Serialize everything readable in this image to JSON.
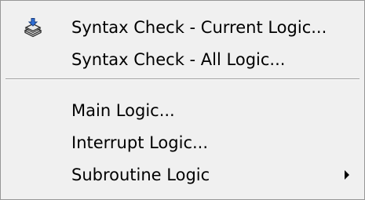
{
  "menu": {
    "items": [
      {
        "label": "Syntax Check - Current Logic...",
        "icon": "syntax-check-icon"
      },
      {
        "label": "Syntax Check - All Logic..."
      },
      {
        "label": "Main Logic..."
      },
      {
        "label": "Interrupt Logic..."
      },
      {
        "label": "Subroutine Logic",
        "has_submenu": true
      }
    ]
  },
  "colors": {
    "menu_background": "#f0f0f0",
    "menu_border": "#979797",
    "text": "#000000"
  }
}
